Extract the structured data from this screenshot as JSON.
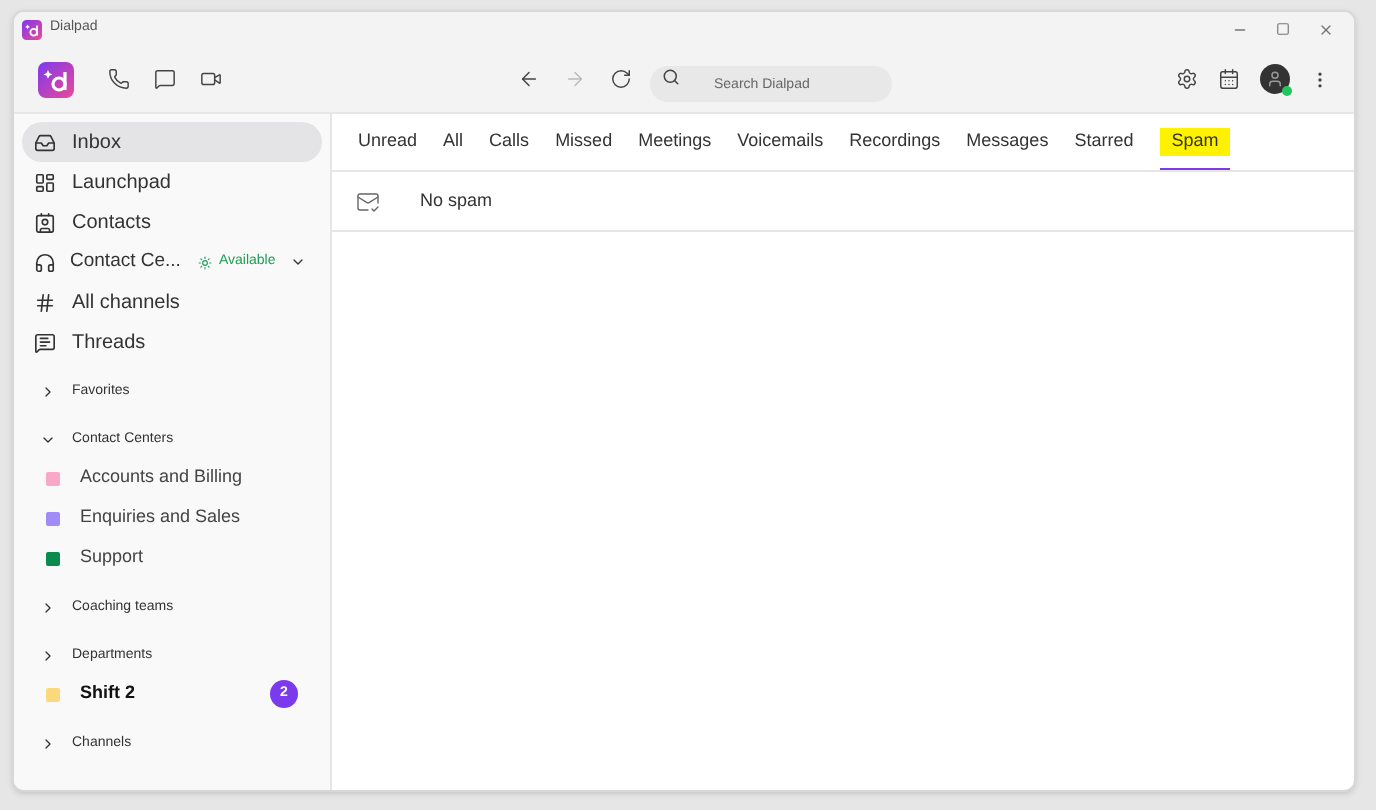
{
  "window": {
    "title": "Dialpad"
  },
  "search": {
    "placeholder": "Search Dialpad"
  },
  "user": {
    "online": true
  },
  "sidebar": {
    "items": [
      {
        "kind": "nav",
        "label": "Inbox",
        "selected": true
      },
      {
        "kind": "nav",
        "label": "Launchpad",
        "selected": false
      },
      {
        "kind": "nav",
        "label": "Contacts",
        "selected": false
      },
      {
        "kind": "status",
        "label": "Contact Ce...",
        "status": "Available"
      },
      {
        "kind": "nav",
        "label": "All channels",
        "selected": false
      },
      {
        "kind": "nav",
        "label": "Threads",
        "selected": false
      },
      {
        "kind": "section",
        "label": "Favorites",
        "expanded": false
      },
      {
        "kind": "section",
        "label": "Contact Centers",
        "expanded": true
      },
      {
        "kind": "channel",
        "label": "Accounts and Billing",
        "color": "#f9a8c8",
        "unread": false
      },
      {
        "kind": "channel",
        "label": "Enquiries and Sales",
        "color": "#a18cf7",
        "unread": false
      },
      {
        "kind": "channel",
        "label": "Support",
        "color": "#0a8a4c",
        "unread": false
      },
      {
        "kind": "section",
        "label": "Coaching teams",
        "expanded": false
      },
      {
        "kind": "section",
        "label": "Departments",
        "expanded": false
      },
      {
        "kind": "channel",
        "label": "Shift 2",
        "color": "#fcd97c",
        "unread": true,
        "badge": "2"
      },
      {
        "kind": "section",
        "label": "Channels",
        "expanded": false
      }
    ]
  },
  "tabs": [
    {
      "label": "Unread",
      "selected": false,
      "highlighted": false
    },
    {
      "label": "All",
      "selected": false,
      "highlighted": false
    },
    {
      "label": "Calls",
      "selected": false,
      "highlighted": false
    },
    {
      "label": "Missed",
      "selected": false,
      "highlighted": false
    },
    {
      "label": "Meetings",
      "selected": false,
      "highlighted": false
    },
    {
      "label": "Voicemails",
      "selected": false,
      "highlighted": false
    },
    {
      "label": "Recordings",
      "selected": false,
      "highlighted": false
    },
    {
      "label": "Messages",
      "selected": false,
      "highlighted": false
    },
    {
      "label": "Starred",
      "selected": false,
      "highlighted": false
    },
    {
      "label": "Spam",
      "selected": true,
      "highlighted": true
    }
  ],
  "empty_state": {
    "message": "No spam"
  }
}
